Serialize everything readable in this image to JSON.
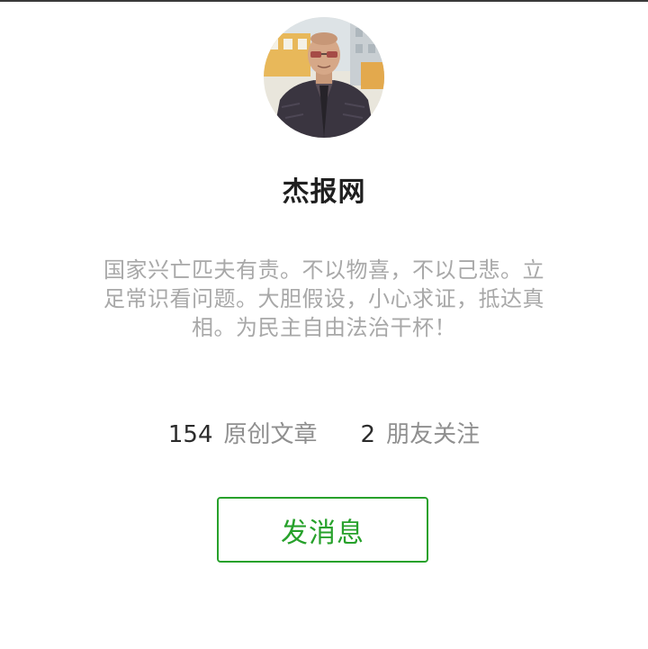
{
  "profile": {
    "name": "杰报网",
    "bio": "国家兴亡匹夫有责。不以物喜，不以己悲。立足常识看问题。大胆假设，小心求证，抵达真相。为民主自由法治干杯！",
    "avatar_icon": "profile-photo"
  },
  "stats": {
    "articles_count": "154",
    "articles_label": "原创文章",
    "friends_count": "2",
    "friends_label": "朋友关注"
  },
  "actions": {
    "message_label": "发消息"
  },
  "colors": {
    "accent": "#27a12b",
    "name": "#1f1f1f",
    "bio": "#a8a8a8",
    "stat_label": "#8f8f8f"
  }
}
